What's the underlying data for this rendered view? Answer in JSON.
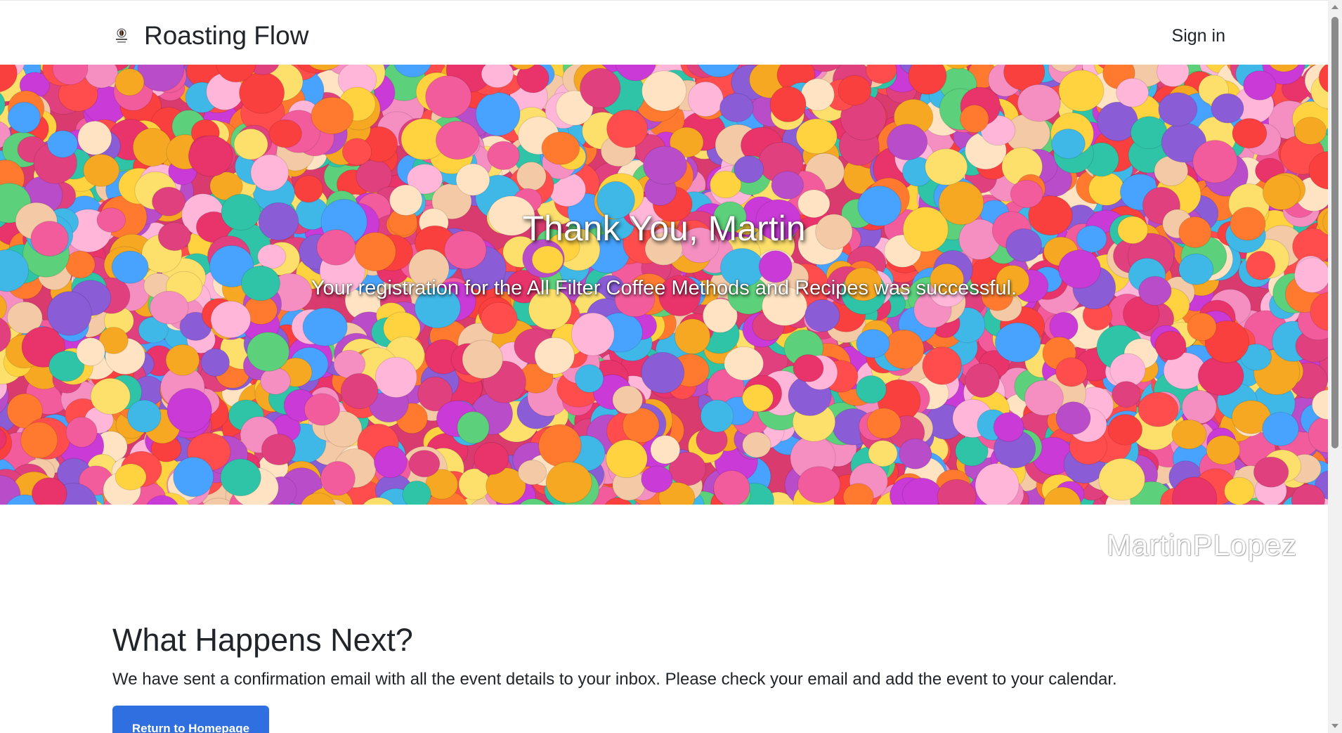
{
  "navbar": {
    "brand_name": "Roasting Flow",
    "logo_icon": "coffee-bean-logo-icon",
    "signin_label": "Sign in"
  },
  "hero": {
    "background": "colorful-confetti-photo",
    "title": "Thank You, Martin",
    "subtitle": "Your registration for the All Filter Coffee Methods and Recipes was successful."
  },
  "watermark": {
    "text": "MartinPLopez"
  },
  "content": {
    "heading": "What Happens Next?",
    "body": "We have sent a confirmation email with all the event details to your inbox. Please check your email and add the event to your calendar.",
    "button_label": "Return to Homepage",
    "button_color": "#2f6fe0"
  },
  "colors": {
    "text": "#212529",
    "background": "#ffffff",
    "scrollbar_thumb": "#8b8b8b"
  }
}
